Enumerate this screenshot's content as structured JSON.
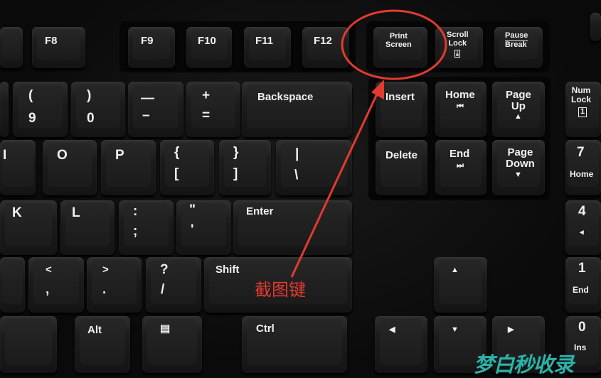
{
  "keys": {
    "f8": "F8",
    "f9": "F9",
    "f10": "F10",
    "f11": "F11",
    "f12": "F12",
    "print_screen": "Print\nScreen",
    "scroll_lock": "Scroll\nLock",
    "pause": "Pause",
    "break": "Break",
    "paren_open": "(",
    "nine": "9",
    "paren_close": ")",
    "zero": "0",
    "underscore": "—",
    "minus": "–",
    "plus": "+",
    "equals": "=",
    "backspace": "Backspace",
    "insert": "Insert",
    "home": "Home",
    "page_up": "Page\nUp",
    "num_lock": "Num\nLock",
    "i": "I",
    "o": "O",
    "p": "P",
    "brace_open": "{",
    "bracket_open": "[",
    "brace_close": "}",
    "bracket_close": "]",
    "pipe": "|",
    "backslash": "\\",
    "delete": "Delete",
    "end": "End",
    "page_down": "Page\nDown",
    "num7": "7",
    "num7_sub": "Home",
    "k": "K",
    "l": "L",
    "colon": ":",
    "semicolon": ";",
    "quote": "\"",
    "apostrophe": "'",
    "enter": "Enter",
    "num4": "4",
    "num4_sub": "◂",
    "lt": "<",
    "comma": ",",
    "gt": ">",
    "period": ".",
    "question": "?",
    "slash": "/",
    "shift": "Shift",
    "num1": "1",
    "num1_sub": "End",
    "alt": "Alt",
    "ctrl": "Ctrl",
    "num0": "0",
    "num0_sub": "Ins",
    "home_glyph": "⏮",
    "end_glyph": "⏭",
    "up_glyph": "▲",
    "down_glyph": "▼",
    "arrow_up": "▲",
    "arrow_down": "▼",
    "arrow_left": "◀",
    "arrow_right": "▶",
    "scroll_glyph": "⤓",
    "numlock_glyph": "1",
    "menu_glyph": "▤"
  },
  "annotation": {
    "label": "截图键",
    "color": "#e33a30"
  },
  "watermark": {
    "text": "梦白秒收录",
    "color": "#2bb3a8"
  }
}
